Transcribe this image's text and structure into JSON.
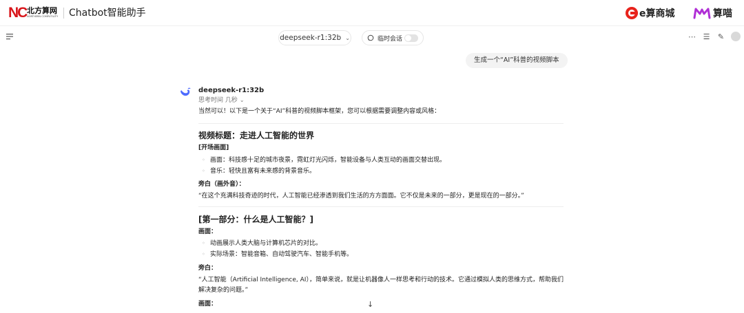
{
  "brand": {
    "logo_mark": "NC",
    "logo_cn": "北方算网",
    "logo_en": "NORTHERN COMPUTILITY",
    "app_title": "Chatbot智能助手",
    "emall_label": "e算商城",
    "suanmiao_label": "算喵",
    "colors": {
      "accent": "#d8161b",
      "suanmiao": "#b02fd6"
    }
  },
  "toolbar": {
    "menu_icon": "menu-icon",
    "model": "deepseek-r1:32b",
    "temp_chat_label": "临时会话",
    "temp_chat_enabled": false,
    "icons": [
      "more-icon",
      "settings-sliders-icon",
      "edit-icon",
      "avatar"
    ]
  },
  "user_message": "生成一个“AI”科普的视频脚本",
  "assistant": {
    "name": "deepseek-r1:32b",
    "thinking": "思考时间 几秒",
    "intro": "当然可以！以下是一个关于“AI”科普的视频脚本框架，您可以根据需要调整内容或风格：",
    "video_title": "视频标题：走进人工智能的世界",
    "opening_heading": "[开场画面]",
    "opening_bullets": [
      "画面：科技感十足的城市夜景，霓虹灯光闪烁，智能设备与人类互动的画面交替出现。",
      "音乐：轻快且富有未来感的背景音乐。"
    ],
    "voiceover_heading": "旁白（画外音）：",
    "voiceover_text": "“在这个充满科技奇迹的时代，人工智能已经渗透到我们生活的方方面面。它不仅是未来的一部分，更是现在的一部分。”",
    "part1_title": "[第一部分：什么是人工智能？]",
    "part1_visual_heading": "画面：",
    "part1_bullets": [
      "动画展示人类大脑与计算机芯片的对比。",
      "实际场景：智能音箱、自动驾驶汽车、智能手机等。"
    ],
    "part1_narration_heading": "旁白：",
    "part1_narration_line1": "“人工智能（Artificial Intelligence, AI），简单来说，就是让机器像人一样思考和行动的技术。它通过模拟人类的思维方式，帮助我们",
    "part1_narration_line2": "解决复杂的问题。”",
    "part2_visual_heading": "画面："
  },
  "scroll_down_icon": "arrow-down-icon"
}
